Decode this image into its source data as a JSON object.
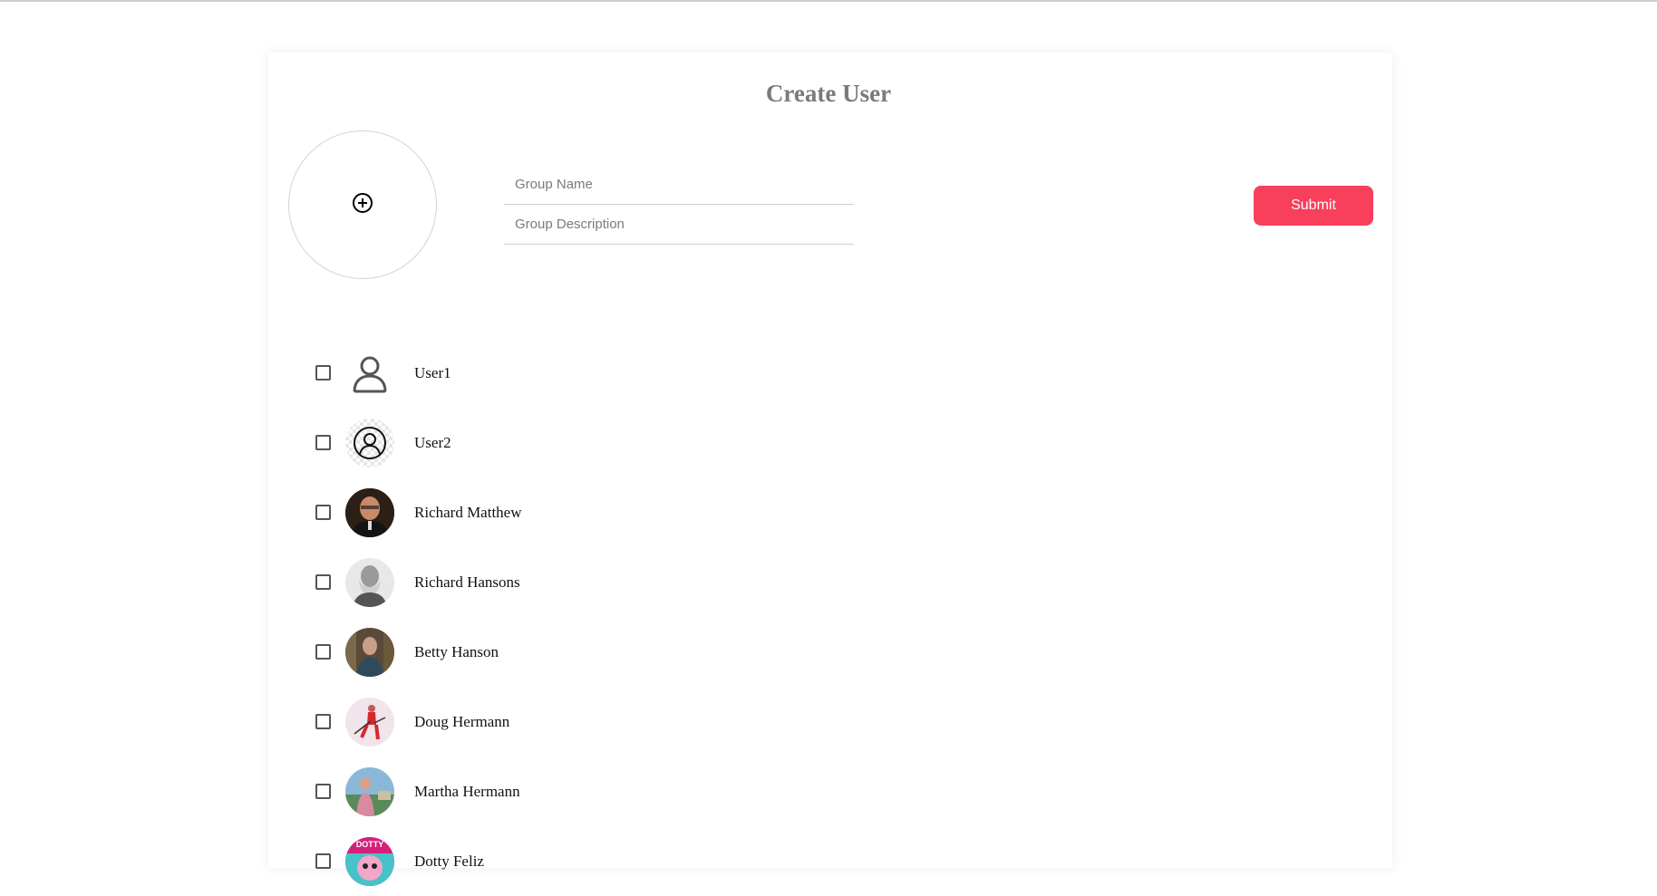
{
  "form": {
    "title": "Create User",
    "group_name_placeholder": "Group Name",
    "group_description_placeholder": "Group Description",
    "submit_label": "Submit",
    "accent_color": "#f83f5b"
  },
  "users": [
    {
      "name": "User1",
      "avatar": "person-outline-icon",
      "checked": false
    },
    {
      "name": "User2",
      "avatar": "person-circle-icon",
      "checked": false
    },
    {
      "name": "Richard Matthew",
      "avatar": "photo",
      "checked": false
    },
    {
      "name": "Richard Hansons",
      "avatar": "photo",
      "checked": false
    },
    {
      "name": "Betty Hanson",
      "avatar": "photo",
      "checked": false
    },
    {
      "name": "Doug Hermann",
      "avatar": "photo",
      "checked": false
    },
    {
      "name": "Martha Hermann",
      "avatar": "photo",
      "checked": false
    },
    {
      "name": "Dotty Feliz",
      "avatar": "photo",
      "avatar_text": "DOTTY",
      "checked": false
    }
  ]
}
